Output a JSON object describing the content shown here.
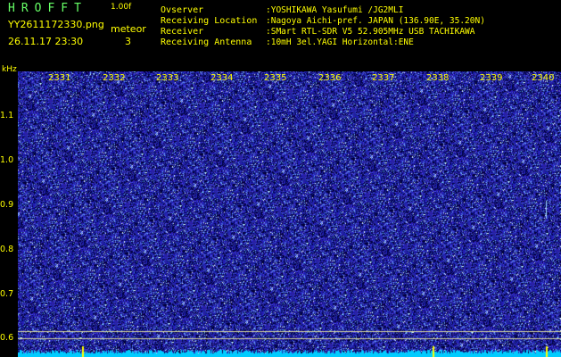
{
  "header": {
    "brand": "HROFFT",
    "version": "1.00f",
    "filename": "YY2611172330.png",
    "datetime": "26.11.17 23:30",
    "meteor_label": "meteor",
    "meteor_count": "3"
  },
  "info": [
    {
      "key": "Ovserver",
      "value": ":YOSHIKAWA Yasufumi /JG2MLI"
    },
    {
      "key": "Receiving Location",
      "value": ":Nagoya Aichi-pref. JAPAN (136.90E, 35.20N)"
    },
    {
      "key": "Receiver",
      "value": ":SMart RTL-SDR V5 52.905MHz USB TACHIKAWA"
    },
    {
      "key": "Receiving Antenna",
      "value": ":10mH 3el.YAGI Horizontal:ENE"
    }
  ],
  "axes": {
    "y_unit": "kHz",
    "y_ticks": [
      "1.1",
      "1.0",
      "0.9",
      "0.8",
      "0.7",
      "0.6"
    ],
    "x_ticks": [
      "2331",
      "2332",
      "2333",
      "2334",
      "2335",
      "2336",
      "2337",
      "2338",
      "2339",
      "2340"
    ]
  },
  "colors": {
    "text": "#ffff00",
    "background": "#000000",
    "spectrogram": "#1a1aa8",
    "noise_floor": "#00ccff"
  }
}
